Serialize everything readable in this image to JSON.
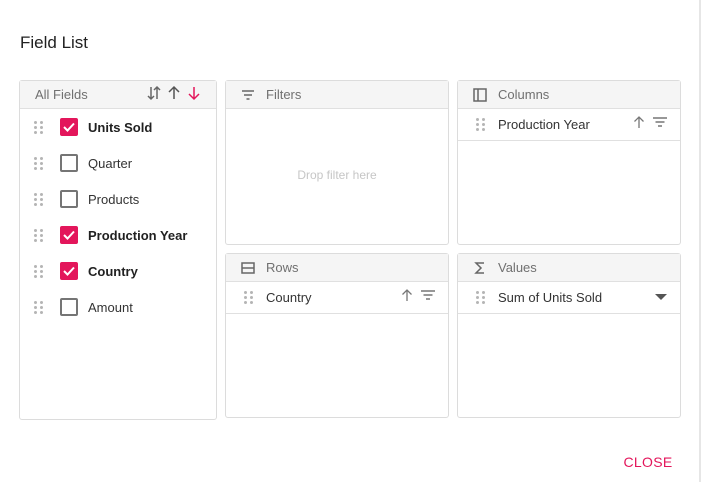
{
  "dialog": {
    "title": "Field List",
    "close_label": "CLOSE"
  },
  "colors": {
    "accent": "#e3165b",
    "border": "#dcdcdc",
    "header_bg": "#f5f5f5"
  },
  "all_fields": {
    "header": "All Fields",
    "sort_icons": [
      "sort-none-icon",
      "sort-ascending-icon",
      "sort-descending-icon"
    ],
    "items": [
      {
        "label": "Units Sold",
        "checked": true
      },
      {
        "label": "Quarter",
        "checked": false
      },
      {
        "label": "Products",
        "checked": false
      },
      {
        "label": "Production Year",
        "checked": true
      },
      {
        "label": "Country",
        "checked": true
      },
      {
        "label": "Amount",
        "checked": false
      }
    ]
  },
  "filters": {
    "header": "Filters",
    "icon": "filter-icon",
    "drop_placeholder": "Drop filter here"
  },
  "columns": {
    "header": "Columns",
    "icon": "columns-icon",
    "items": [
      {
        "label": "Production Year"
      }
    ]
  },
  "rows": {
    "header": "Rows",
    "icon": "rows-icon",
    "items": [
      {
        "label": "Country"
      }
    ]
  },
  "values": {
    "header": "Values",
    "icon": "sigma-icon",
    "items": [
      {
        "label": "Sum of Units Sold"
      }
    ]
  }
}
